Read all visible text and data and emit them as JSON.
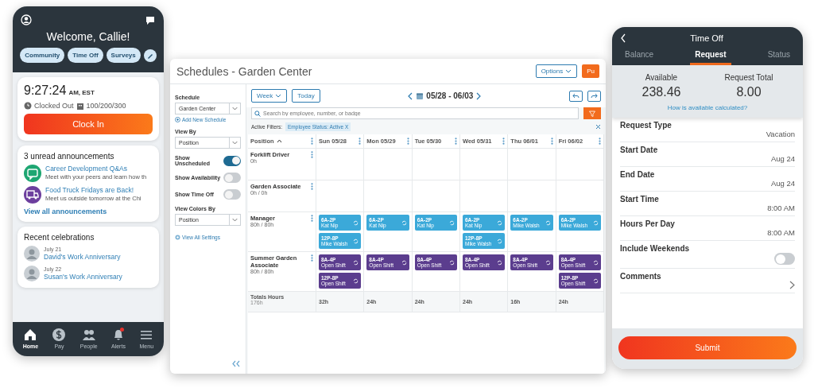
{
  "home_app": {
    "greeting": "Welcome, Callie!",
    "quick_links": [
      {
        "label": "Community"
      },
      {
        "label": "Time Off"
      },
      {
        "label": "Surveys"
      }
    ],
    "clock": {
      "time": "9:27:24",
      "meridiem": "AM, EST",
      "status": "Clocked Out",
      "location": "100/200/300",
      "button": "Clock In"
    },
    "announcements": {
      "title": "3 unread announcements",
      "items": [
        {
          "title": "Career Development Q&As",
          "body": "Meet with your peers and learn how th",
          "color": "#1ea672",
          "kind": "chat"
        },
        {
          "title": "Food Truck Fridays are Back!",
          "body": "Meet us outside tomorrow at the Chi",
          "color": "#6d3f9e",
          "kind": "truck"
        }
      ],
      "link": "View all announcements"
    },
    "celebrations": {
      "title": "Recent celebrations",
      "items": [
        {
          "date": "July 21",
          "title": "David's Work Anniversary"
        },
        {
          "date": "July 22",
          "title": "Susan's Work Anniversary"
        }
      ]
    },
    "nav": [
      {
        "label": "Home",
        "kind": "home",
        "selected": true,
        "badge": false
      },
      {
        "label": "Pay",
        "kind": "pay",
        "selected": false,
        "badge": false
      },
      {
        "label": "People",
        "kind": "people",
        "selected": false,
        "badge": false
      },
      {
        "label": "Alerts",
        "kind": "alerts",
        "selected": false,
        "badge": true
      },
      {
        "label": "Menu",
        "kind": "menu",
        "selected": false,
        "badge": false
      }
    ]
  },
  "schedule": {
    "title": "Schedules - Garden Center",
    "options_button": "Options",
    "publish_button": "Pu",
    "sidebar": {
      "schedule_label": "Schedule",
      "schedule_value": "Garden Center",
      "add_link": "Add New Schedule",
      "view_by_label": "View By",
      "view_by_value": "Position",
      "toggles": [
        {
          "label": "Show Unscheduled",
          "on": true
        },
        {
          "label": "Show Availability",
          "on": false
        },
        {
          "label": "Show Time Off",
          "on": false
        }
      ],
      "colors_label": "View Colors By",
      "colors_value": "Position",
      "settings_link": "View All Settings"
    },
    "toolbar": {
      "week_button": "Week",
      "today_button": "Today",
      "date_range": "05/28 - 06/03"
    },
    "search": {
      "placeholder": "Search by employee, number, or badge"
    },
    "filters": {
      "label": "Active Filters:",
      "chips": [
        "Employee Status: Active X"
      ]
    },
    "grid": {
      "columns": [
        "Position",
        "Sun 05/28",
        "Mon 05/29",
        "Tue 05/30",
        "Wed 05/31",
        "Thu 06/01",
        "Fri 06/02"
      ],
      "rows": [
        {
          "name": "Forklift Driver",
          "hours": "0h"
        },
        {
          "name": "Garden Associate",
          "hours": "0h / 0h"
        },
        {
          "name": "Manager",
          "hours": "80h / 80h",
          "color": "#3ba9d9",
          "days": [
            [
              {
                "time": "6A-2P",
                "who": "Kat Nip"
              },
              {
                "time": "12P-8P",
                "who": "Mike Walsh"
              }
            ],
            [
              {
                "time": "6A-2P",
                "who": "Kat Nip"
              }
            ],
            [
              {
                "time": "6A-2P",
                "who": "Kat Nip"
              }
            ],
            [
              {
                "time": "6A-2P",
                "who": "Kat Nip"
              },
              {
                "time": "12P-8P",
                "who": "Mike Walsh"
              }
            ],
            [
              {
                "time": "6A-2P",
                "who": "Mike Walsh"
              }
            ],
            [
              {
                "time": "6A-2P",
                "who": "Mike Walsh"
              }
            ]
          ]
        },
        {
          "name": "Summer Garden Associate",
          "hours": "80h / 80h",
          "color": "#5b3d8e",
          "days": [
            [
              {
                "time": "8A-4P",
                "who": "Open Shift"
              },
              {
                "time": "12P-8P",
                "who": "Open Shift"
              }
            ],
            [
              {
                "time": "8A-4P",
                "who": "Open Shift"
              }
            ],
            [
              {
                "time": "8A-4P",
                "who": "Open Shift"
              }
            ],
            [
              {
                "time": "8A-4P",
                "who": "Open Shift"
              }
            ],
            [
              {
                "time": "8A-4P",
                "who": "Open Shift"
              }
            ],
            [
              {
                "time": "8A-4P",
                "who": "Open Shift"
              },
              {
                "time": "12P-8P",
                "who": "Open Shift"
              }
            ]
          ]
        }
      ],
      "totals": {
        "label": "Totals Hours",
        "total": "176h",
        "days": [
          "32h",
          "24h",
          "24h",
          "24h",
          "16h",
          "24h"
        ]
      }
    }
  },
  "time_off": {
    "title": "Time Off",
    "tabs": [
      {
        "label": "Balance",
        "selected": false
      },
      {
        "label": "Request",
        "selected": true
      },
      {
        "label": "Status",
        "selected": false
      }
    ],
    "summary": [
      {
        "label": "Available",
        "value": "238.46"
      },
      {
        "label": "Request Total",
        "value": "8.00"
      }
    ],
    "summary_link": "How is available calculated?",
    "fields": [
      {
        "kind": "value",
        "label": "Request Type",
        "value": "Vacation"
      },
      {
        "kind": "value",
        "label": "Start Date",
        "value": "Aug 24"
      },
      {
        "kind": "value",
        "label": "End Date",
        "value": "Aug 24"
      },
      {
        "kind": "value",
        "label": "Start Time",
        "value": "8:00 AM"
      },
      {
        "kind": "value",
        "label": "Hours Per Day",
        "value": "8:00 AM"
      },
      {
        "kind": "toggle",
        "label": "Include Weekends",
        "on": false
      },
      {
        "kind": "chevron",
        "label": "Comments"
      }
    ],
    "submit": "Submit"
  }
}
